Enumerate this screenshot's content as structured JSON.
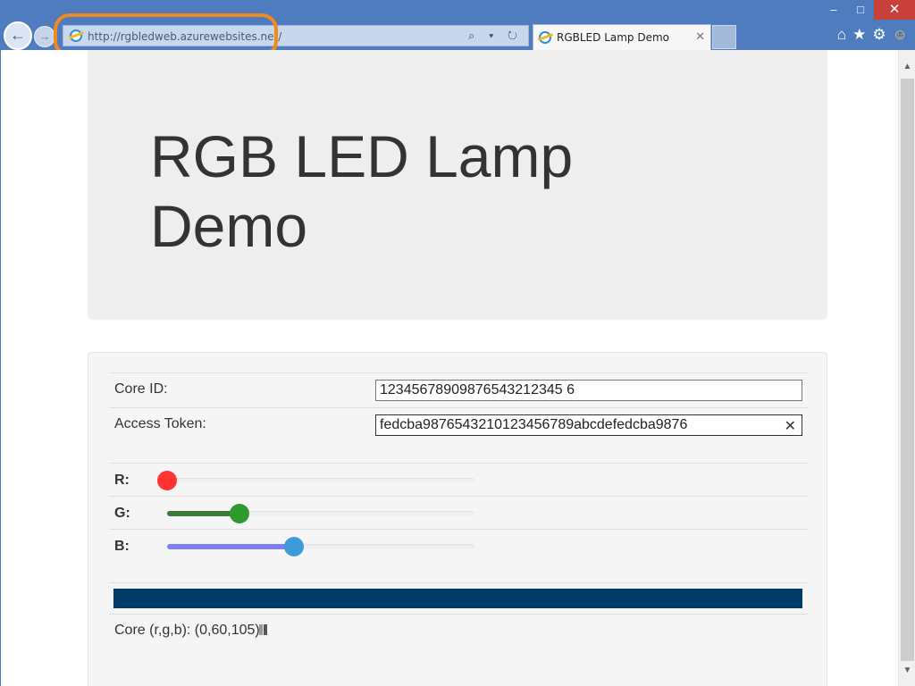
{
  "browser": {
    "url": "http://rgbledweb.azurewebsites.net/",
    "tab_title": "RGBLED Lamp Demo",
    "back_glyph": "←",
    "forward_glyph": "→",
    "tab_close_glyph": "✕",
    "window_controls": {
      "minimize": "–",
      "maximize": "□",
      "close": "✕"
    },
    "address_icons": "⌕ ▾ ↻",
    "tools": {
      "home": "⌂",
      "favorites": "★",
      "settings": "⚙",
      "feedback": "☺"
    }
  },
  "page": {
    "heading": "RGB LED Lamp Demo",
    "core_id": {
      "label": "Core ID:",
      "value": "12345678909876543212345 6"
    },
    "access_token": {
      "label": "Access Token:",
      "value": "fedcba9876543210123456789abcdefedcba9876",
      "clear_glyph": "✕"
    },
    "sliders": [
      {
        "label": "R:",
        "value": 0,
        "max": 255,
        "fill_color": "#ff3333",
        "thumb_color": "#ff3333"
      },
      {
        "label": "G:",
        "value": 60,
        "max": 255,
        "fill_color": "#3b7a3b",
        "thumb_color": "#2e9a2e"
      },
      {
        "label": "B:",
        "value": 105,
        "max": 255,
        "fill_color": "#7f7ff5",
        "thumb_color": "#3d9bd9"
      }
    ],
    "color_preview": "#003c69",
    "core_status": "Core (r,g,b): (0,60,105)"
  }
}
